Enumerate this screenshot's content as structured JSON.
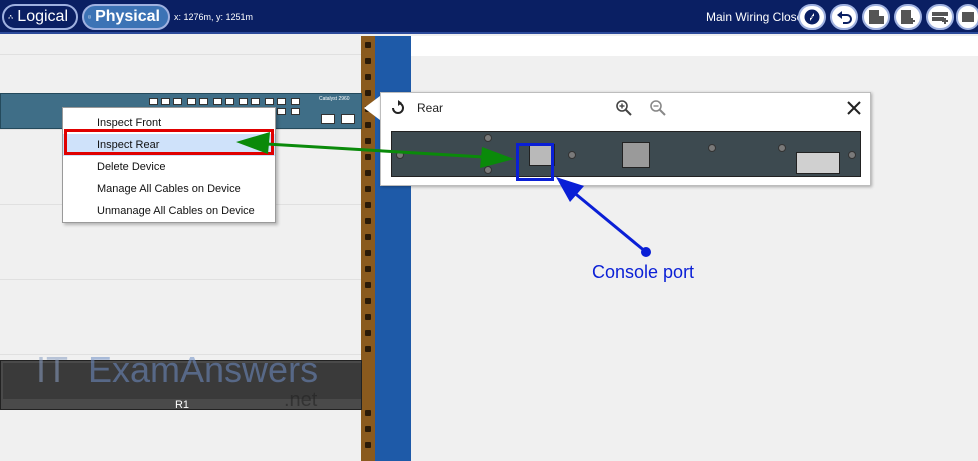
{
  "topbar": {
    "logical_label": "Logical",
    "physical_label": "Physical",
    "coords": "x: 1276m, y: 1251m",
    "location": "Main Wiring Closet"
  },
  "context_menu": {
    "items": [
      {
        "label": "Inspect Front"
      },
      {
        "label": "Inspect Rear"
      },
      {
        "label": "Delete Device"
      },
      {
        "label": "Manage All Cables on Device"
      },
      {
        "label": "Unmanage All Cables on Device"
      }
    ]
  },
  "popup": {
    "title": "Rear"
  },
  "annotation": {
    "console_text": "Console port"
  },
  "router": {
    "label": "R1"
  },
  "switch": {
    "label": "Catalyst 2960"
  },
  "watermark": {
    "text": "ITExamAnswers.net"
  },
  "colors": {
    "topbar": "#0a1f63",
    "highlight_red": "#e00000",
    "annotation_blue": "#0a1fd6",
    "arrow_green": "#0a8a0a"
  }
}
